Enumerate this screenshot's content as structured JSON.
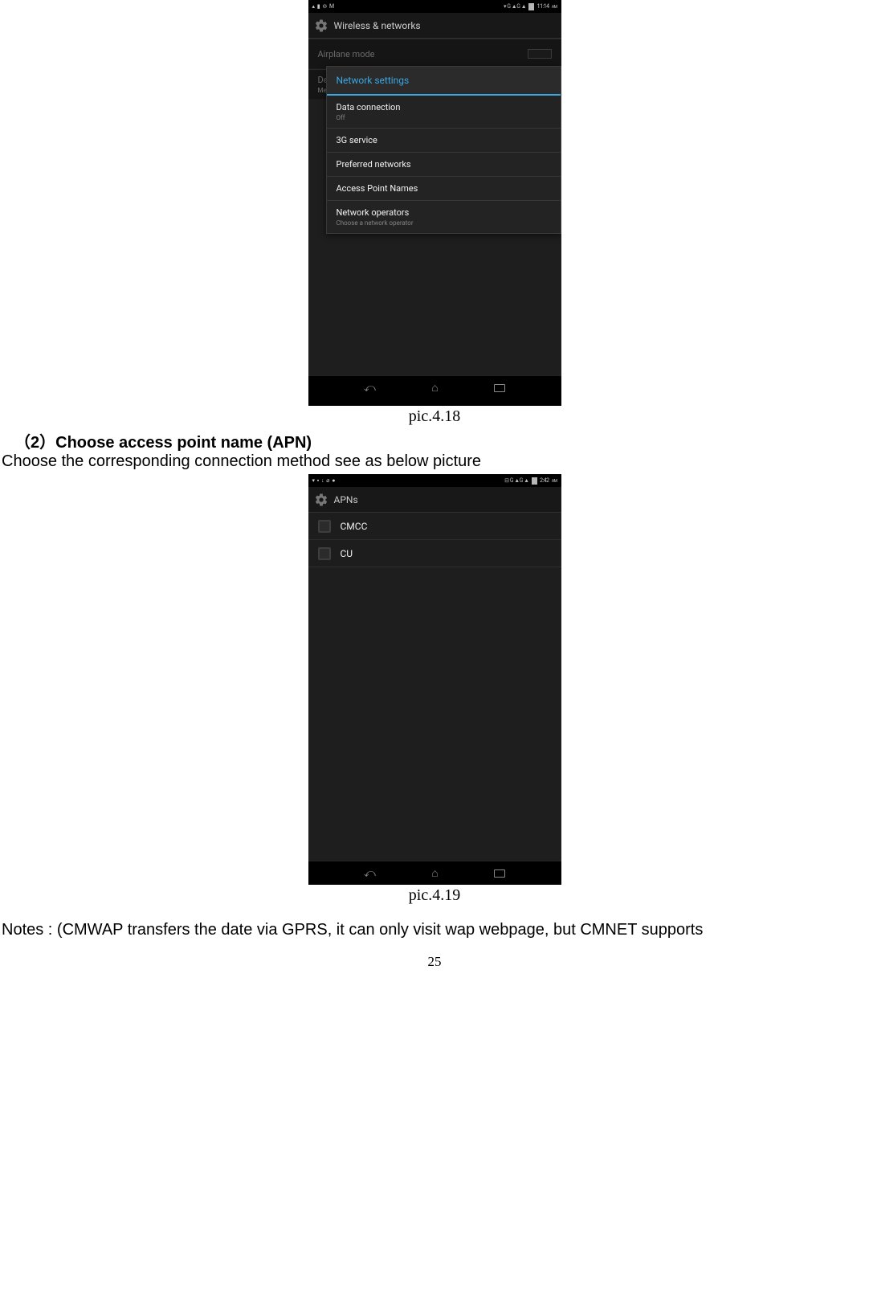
{
  "figure1": {
    "statusLeft": [
      "▴",
      "▮",
      "⊖",
      "M"
    ],
    "statusRightPrefix": "▾ G ▲G ▲",
    "statusTime": "11:14",
    "statusTimeSuffix": "AM",
    "appTitle": "Wireless & networks",
    "row1": "Airplane mode",
    "row2": "Default SMS app",
    "row2sub": "Messaging",
    "dialogTitle": "Network settings",
    "d1": {
      "title": "Data connection",
      "sub": "Off"
    },
    "d2": {
      "title": "3G service"
    },
    "d3": {
      "title": "Preferred networks"
    },
    "d4": {
      "title": "Access Point Names"
    },
    "d5": {
      "title": "Network operators",
      "sub": "Choose a network operator"
    }
  },
  "caption1": "pic.4.18",
  "heading": "（2）Choose access point name (APN)",
  "bodyText1": "Choose the corresponding connection method see as below picture",
  "figure2": {
    "statusLeft": [
      "▾",
      "▪",
      "↓",
      "⌀",
      "●"
    ],
    "statusRightPrefix": "⊟ G ▲G ▲",
    "statusTime": "2:42",
    "statusTimeSuffix": "AM",
    "appTitle": "APNs",
    "items": [
      "CMCC",
      "CU"
    ]
  },
  "caption2": "pic.4.19",
  "bodyText2": "Notes : (CMWAP transfers the date via GPRS, it can only visit wap webpage, but CMNET supports",
  "pageNumber": "25"
}
